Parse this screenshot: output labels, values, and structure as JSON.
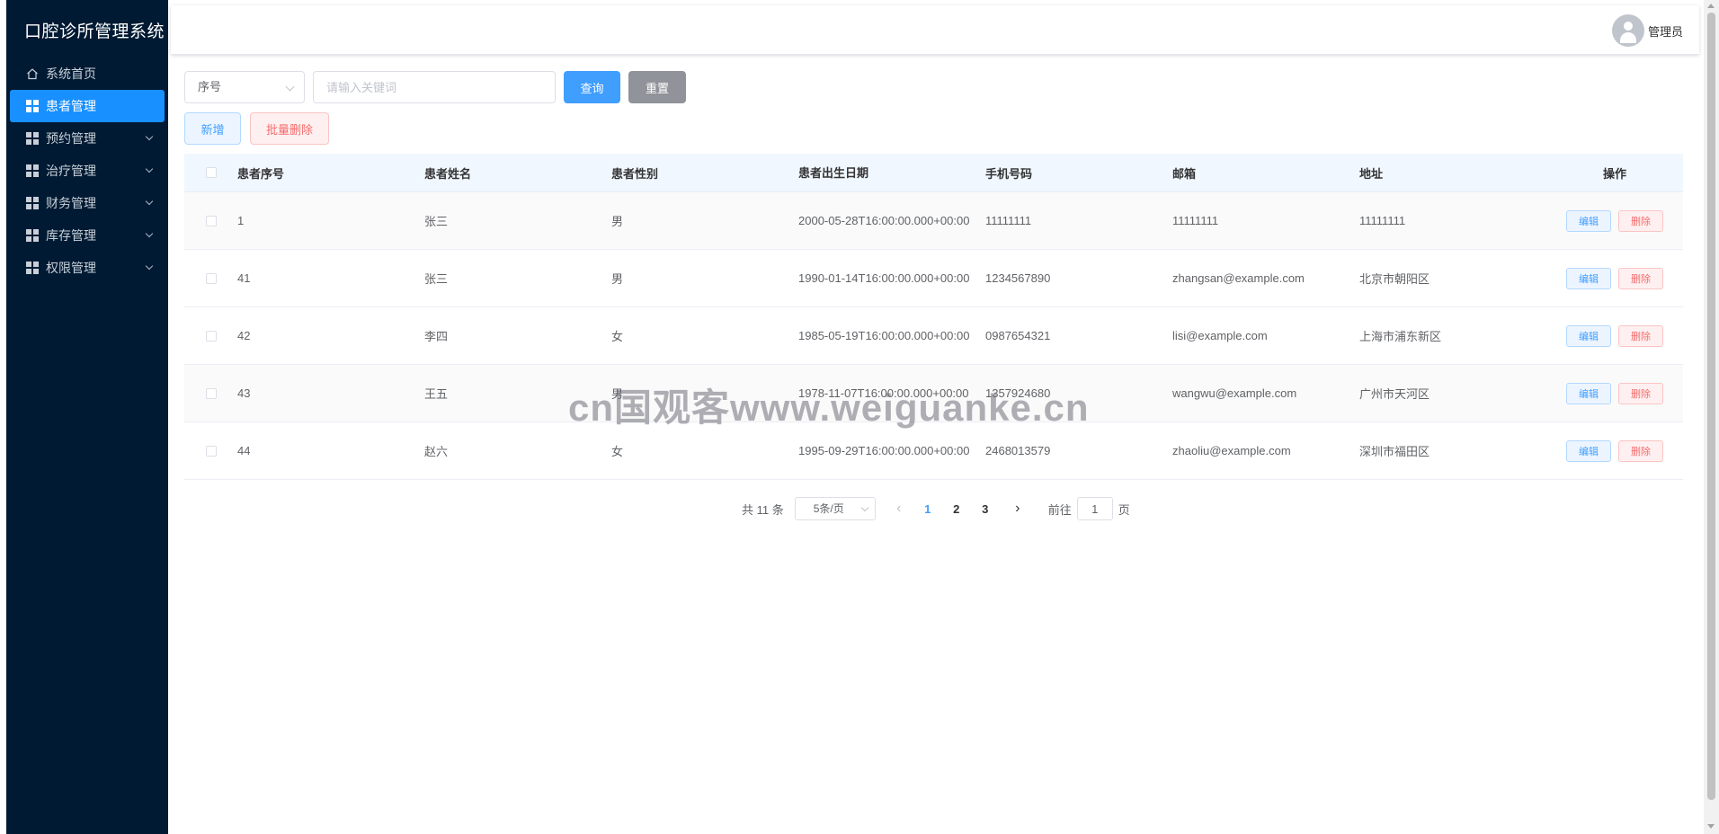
{
  "app": {
    "title": "口腔诊所管理系统"
  },
  "sidebar": {
    "items": [
      {
        "label": "系统首页",
        "icon": "home-icon"
      },
      {
        "label": "患者管理",
        "icon": "grid-icon"
      },
      {
        "label": "预约管理",
        "icon": "grid-icon"
      },
      {
        "label": "治疗管理",
        "icon": "grid-icon"
      },
      {
        "label": "财务管理",
        "icon": "grid-icon"
      },
      {
        "label": "库存管理",
        "icon": "grid-icon"
      },
      {
        "label": "权限管理",
        "icon": "grid-icon"
      }
    ],
    "active": "患者管理"
  },
  "header": {
    "user_name": "管理员"
  },
  "search": {
    "field_select": "序号",
    "keyword_placeholder": "请输入关键词",
    "query_label": "查询",
    "reset_label": "重置"
  },
  "actions": {
    "add_label": "新增",
    "batch_delete_label": "批量删除"
  },
  "table": {
    "columns": [
      "患者序号",
      "患者姓名",
      "患者性别",
      "患者出生日期",
      "手机号码",
      "邮箱",
      "地址",
      "操作"
    ],
    "rows": [
      {
        "id": "1",
        "name": "张三",
        "gender": "男",
        "birth": "2000-05-28T16:00:00.000+00:00",
        "phone": "11111111",
        "email": "11111111",
        "address": "11111111"
      },
      {
        "id": "41",
        "name": "张三",
        "gender": "男",
        "birth": "1990-01-14T16:00:00.000+00:00",
        "phone": "1234567890",
        "email": "zhangsan@example.com",
        "address": "北京市朝阳区"
      },
      {
        "id": "42",
        "name": "李四",
        "gender": "女",
        "birth": "1985-05-19T16:00:00.000+00:00",
        "phone": "0987654321",
        "email": "lisi@example.com",
        "address": "上海市浦东新区"
      },
      {
        "id": "43",
        "name": "王五",
        "gender": "男",
        "birth": "1978-11-07T16:00:00.000+00:00",
        "phone": "1357924680",
        "email": "wangwu@example.com",
        "address": "广州市天河区"
      },
      {
        "id": "44",
        "name": "赵六",
        "gender": "女",
        "birth": "1995-09-29T16:00:00.000+00:00",
        "phone": "2468013579",
        "email": "zhaoliu@example.com",
        "address": "深圳市福田区"
      }
    ],
    "edit_label": "编辑",
    "delete_label": "删除"
  },
  "pagination": {
    "total_text": "共 11 条",
    "page_size": "5条/页",
    "pages": [
      "1",
      "2",
      "3"
    ],
    "current_page": "1",
    "goto_label": "前往",
    "goto_value": "1",
    "page_suffix": "页"
  },
  "watermark": {
    "text": "cn国观客www.weiguanke.cn"
  },
  "colors": {
    "sidebar_bg": "#011a33",
    "accent": "#1890ff",
    "primary": "#409eff",
    "danger": "#f56c6c",
    "gray_button": "#909399"
  }
}
